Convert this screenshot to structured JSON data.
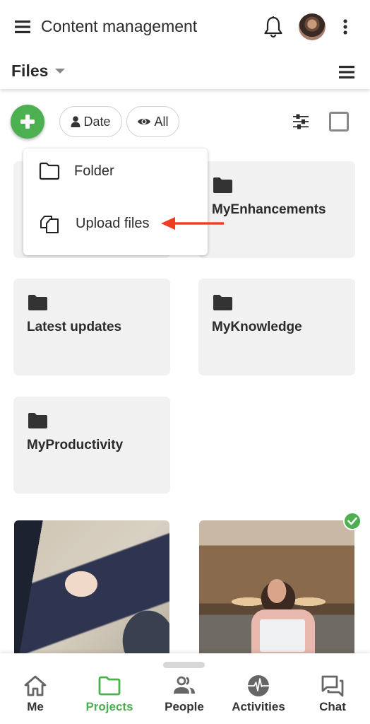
{
  "appbar": {
    "title": "Content management",
    "icons": {
      "menu": "hamburger-icon",
      "notifications": "bell-icon",
      "avatar": "user-avatar",
      "more": "kebab-menu-icon"
    }
  },
  "files_bar": {
    "title": "Files",
    "dropdown_icon": "caret-down-icon",
    "view_menu_icon": "hamburger-icon"
  },
  "toolbar": {
    "add_button_icon": "plus-icon",
    "chips": [
      {
        "label": "Date",
        "icon": "person-icon"
      },
      {
        "label": "All",
        "icon": "eye-icon"
      }
    ],
    "filter_icon": "tune-sliders-icon",
    "select_all_icon": "checkbox-icon"
  },
  "add_menu": {
    "items": [
      {
        "label": "Folder",
        "icon": "folder-outline-icon"
      },
      {
        "label": "Upload files",
        "icon": "copy-files-icon"
      }
    ],
    "annotation": "red-arrow-pointing-to-upload-files",
    "annotation_color": "#f03c1f"
  },
  "folders": [
    {
      "name": ""
    },
    {
      "name": "MyEnhancements"
    },
    {
      "name": "Latest updates"
    },
    {
      "name": "MyKnowledge"
    },
    {
      "name": "MyProductivity"
    }
  ],
  "images": [
    {
      "description": "business people reviewing documents",
      "selected": false
    },
    {
      "description": "woman smiling with laptop in lounge",
      "selected": true
    }
  ],
  "bottom_nav": {
    "items": [
      {
        "label": "Me",
        "icon": "home-icon",
        "active": false
      },
      {
        "label": "Projects",
        "icon": "folder-icon",
        "active": true
      },
      {
        "label": "People",
        "icon": "people-icon",
        "active": false
      },
      {
        "label": "Activities",
        "icon": "activity-pulse-icon",
        "active": false
      },
      {
        "label": "Chat",
        "icon": "chat-icon",
        "active": false
      }
    ]
  },
  "colors": {
    "accent": "#4caf50",
    "text": "#2b2b2b",
    "card_bg": "#f1f1f1",
    "icon_gray": "#666666",
    "annotation_red": "#f03c1f"
  }
}
